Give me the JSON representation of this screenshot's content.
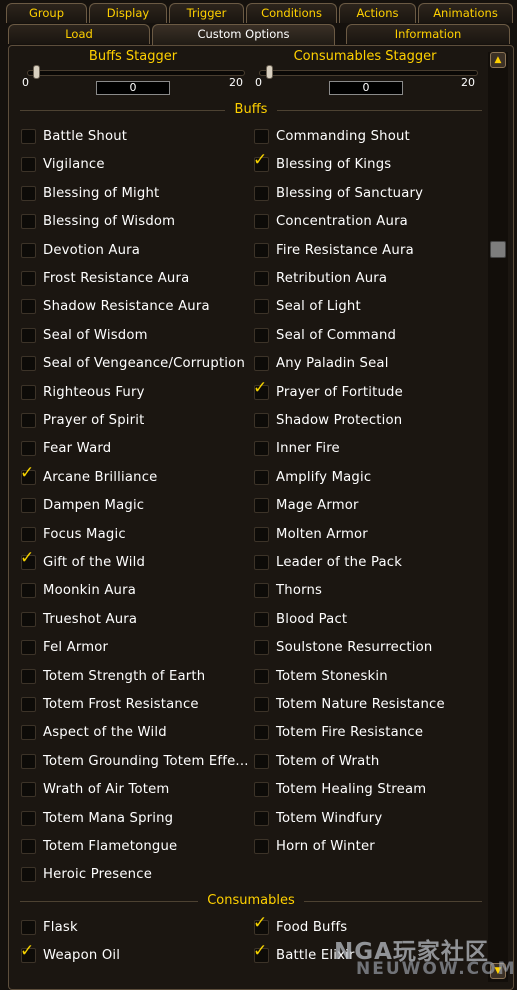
{
  "tabs_row1": [
    "Group",
    "Display",
    "Trigger",
    "Conditions",
    "Actions",
    "Animations"
  ],
  "tabs_row2": [
    "Load",
    "Custom Options",
    "Information"
  ],
  "active_tab": "Custom Options",
  "buffs_stagger": {
    "title": "Buffs Stagger",
    "min": "0",
    "max": "20",
    "value": "0"
  },
  "consumables_stagger": {
    "title": "Consumables Stagger",
    "min": "0",
    "max": "20",
    "value": "0"
  },
  "buffs_header": "Buffs",
  "buffs": [
    {
      "label": "Battle Shout",
      "checked": false
    },
    {
      "label": "Commanding Shout",
      "checked": false
    },
    {
      "label": "Vigilance",
      "checked": false
    },
    {
      "label": "Blessing of Kings",
      "checked": true
    },
    {
      "label": "Blessing of Might",
      "checked": false
    },
    {
      "label": "Blessing of Sanctuary",
      "checked": false
    },
    {
      "label": "Blessing of Wisdom",
      "checked": false
    },
    {
      "label": "Concentration Aura",
      "checked": false
    },
    {
      "label": "Devotion Aura",
      "checked": false
    },
    {
      "label": "Fire Resistance Aura",
      "checked": false
    },
    {
      "label": "Frost Resistance Aura",
      "checked": false
    },
    {
      "label": "Retribution Aura",
      "checked": false
    },
    {
      "label": "Shadow Resistance Aura",
      "checked": false
    },
    {
      "label": "Seal of Light",
      "checked": false
    },
    {
      "label": "Seal of Wisdom",
      "checked": false
    },
    {
      "label": "Seal of Command",
      "checked": false
    },
    {
      "label": "Seal of Vengeance/Corruption",
      "checked": false
    },
    {
      "label": "Any Paladin Seal",
      "checked": false
    },
    {
      "label": "Righteous Fury",
      "checked": false
    },
    {
      "label": "Prayer of Fortitude",
      "checked": true
    },
    {
      "label": "Prayer of Spirit",
      "checked": false
    },
    {
      "label": "Shadow Protection",
      "checked": false
    },
    {
      "label": "Fear Ward",
      "checked": false
    },
    {
      "label": "Inner Fire",
      "checked": false
    },
    {
      "label": "Arcane Brilliance",
      "checked": true
    },
    {
      "label": "Amplify Magic",
      "checked": false
    },
    {
      "label": "Dampen Magic",
      "checked": false
    },
    {
      "label": "Mage Armor",
      "checked": false
    },
    {
      "label": "Focus Magic",
      "checked": false
    },
    {
      "label": "Molten Armor",
      "checked": false
    },
    {
      "label": "Gift of the Wild",
      "checked": true
    },
    {
      "label": "Leader of the Pack",
      "checked": false
    },
    {
      "label": "Moonkin Aura",
      "checked": false
    },
    {
      "label": "Thorns",
      "checked": false
    },
    {
      "label": "Trueshot Aura",
      "checked": false
    },
    {
      "label": "Blood Pact",
      "checked": false
    },
    {
      "label": "Fel Armor",
      "checked": false
    },
    {
      "label": "Soulstone Resurrection",
      "checked": false
    },
    {
      "label": "Totem Strength of Earth",
      "checked": false
    },
    {
      "label": "Totem Stoneskin",
      "checked": false
    },
    {
      "label": "Totem Frost Resistance",
      "checked": false
    },
    {
      "label": "Totem Nature Resistance",
      "checked": false
    },
    {
      "label": "Aspect of the Wild",
      "checked": false
    },
    {
      "label": "Totem Fire Resistance",
      "checked": false
    },
    {
      "label": "Totem Grounding Totem Effe...",
      "checked": false
    },
    {
      "label": "Totem of Wrath",
      "checked": false
    },
    {
      "label": "Wrath of Air Totem",
      "checked": false
    },
    {
      "label": "Totem Healing Stream",
      "checked": false
    },
    {
      "label": "Totem Mana Spring",
      "checked": false
    },
    {
      "label": "Totem Windfury",
      "checked": false
    },
    {
      "label": "Totem Flametongue",
      "checked": false
    },
    {
      "label": "Horn of Winter",
      "checked": false
    },
    {
      "label": "Heroic Presence",
      "checked": false
    }
  ],
  "consumables_header": "Consumables",
  "consumables": [
    {
      "label": "Flask",
      "checked": false
    },
    {
      "label": "Food Buffs",
      "checked": true
    },
    {
      "label": "Weapon Oil",
      "checked": true
    },
    {
      "label": "Battle Elixir",
      "checked": true
    }
  ],
  "scroll_up_icon": "chevron-up-icon",
  "scroll_down_icon": "chevron-down-icon",
  "watermark": {
    "line1": "NGA玩家社区",
    "line2": "NEUWOW.COM"
  },
  "colors": {
    "gold": "#ffd100",
    "text": "#ffffff",
    "check": "#f4d100",
    "background": "#1b1611"
  }
}
